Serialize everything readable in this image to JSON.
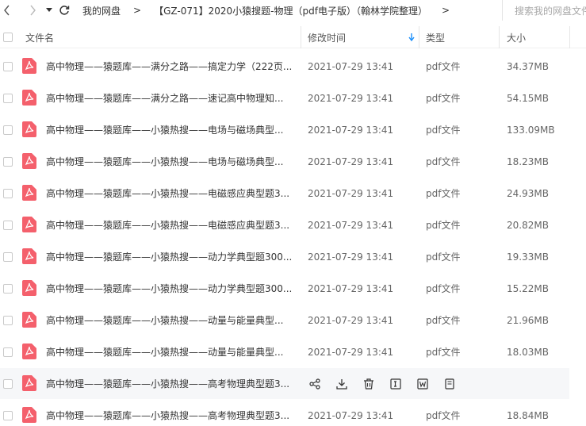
{
  "nav": {
    "back_glyph": "‹",
    "forward_glyph": "›",
    "dropdown_glyph": "▾",
    "refresh_glyph": "↻"
  },
  "breadcrumb": {
    "root": "我的网盘",
    "sep1": ">",
    "folder": "【GZ-071】2020小猿搜题-物理（pdf电子版）（翰林学院整理）",
    "sep2": ">"
  },
  "search": {
    "placeholder": "搜索我的网盘文件"
  },
  "columns": {
    "name": "文件名",
    "modified": "修改时间",
    "type": "类型",
    "size": "大小"
  },
  "colors": {
    "pdf_icon": "#f4606c",
    "sort_arrow": "#1a8ffa",
    "hover_row": "#f6f7f9"
  },
  "files": [
    {
      "name": "高中物理——猿题库——满分之路——搞定力学（222页...",
      "modified": "2021-07-29 13:41",
      "type": "pdf文件",
      "size": "34.37MB"
    },
    {
      "name": "高中物理——猿题库——满分之路——速记高中物理知...",
      "modified": "2021-07-29 13:41",
      "type": "pdf文件",
      "size": "54.15MB"
    },
    {
      "name": "高中物理——猿题库——小猿热搜——电场与磁场典型...",
      "modified": "2021-07-29 13:41",
      "type": "pdf文件",
      "size": "133.09MB"
    },
    {
      "name": "高中物理——猿题库——小猿热搜——电场与磁场典型...",
      "modified": "2021-07-29 13:41",
      "type": "pdf文件",
      "size": "18.23MB"
    },
    {
      "name": "高中物理——猿题库——小猿热搜——电磁感应典型题3...",
      "modified": "2021-07-29 13:41",
      "type": "pdf文件",
      "size": "24.93MB"
    },
    {
      "name": "高中物理——猿题库——小猿热搜——电磁感应典型题3...",
      "modified": "2021-07-29 13:41",
      "type": "pdf文件",
      "size": "20.82MB"
    },
    {
      "name": "高中物理——猿题库——小猿热搜——动力学典型题300...",
      "modified": "2021-07-29 13:41",
      "type": "pdf文件",
      "size": "19.33MB"
    },
    {
      "name": "高中物理——猿题库——小猿热搜——动力学典型题300...",
      "modified": "2021-07-29 13:41",
      "type": "pdf文件",
      "size": "15.22MB"
    },
    {
      "name": "高中物理——猿题库——小猿热搜——动量与能量典型...",
      "modified": "2021-07-29 13:41",
      "type": "pdf文件",
      "size": "21.96MB"
    },
    {
      "name": "高中物理——猿题库——小猿热搜——动量与能量典型...",
      "modified": "2021-07-29 13:41",
      "type": "pdf文件",
      "size": "18.03MB"
    },
    {
      "name": "高中物理——猿题库——小猿热搜——高考物理典型题3...",
      "modified": "",
      "type": "",
      "size": "",
      "hovered": true
    },
    {
      "name": "高中物理——猿题库——小猿热搜——高考物理典型题3...",
      "modified": "2021-07-29 13:41",
      "type": "pdf文件",
      "size": "18.84MB"
    }
  ],
  "row_actions": [
    {
      "icon": "share-icon"
    },
    {
      "icon": "download-icon"
    },
    {
      "icon": "trash-icon"
    },
    {
      "icon": "rename-icon"
    },
    {
      "icon": "word-convert-icon"
    },
    {
      "icon": "more-doc-icon"
    }
  ]
}
